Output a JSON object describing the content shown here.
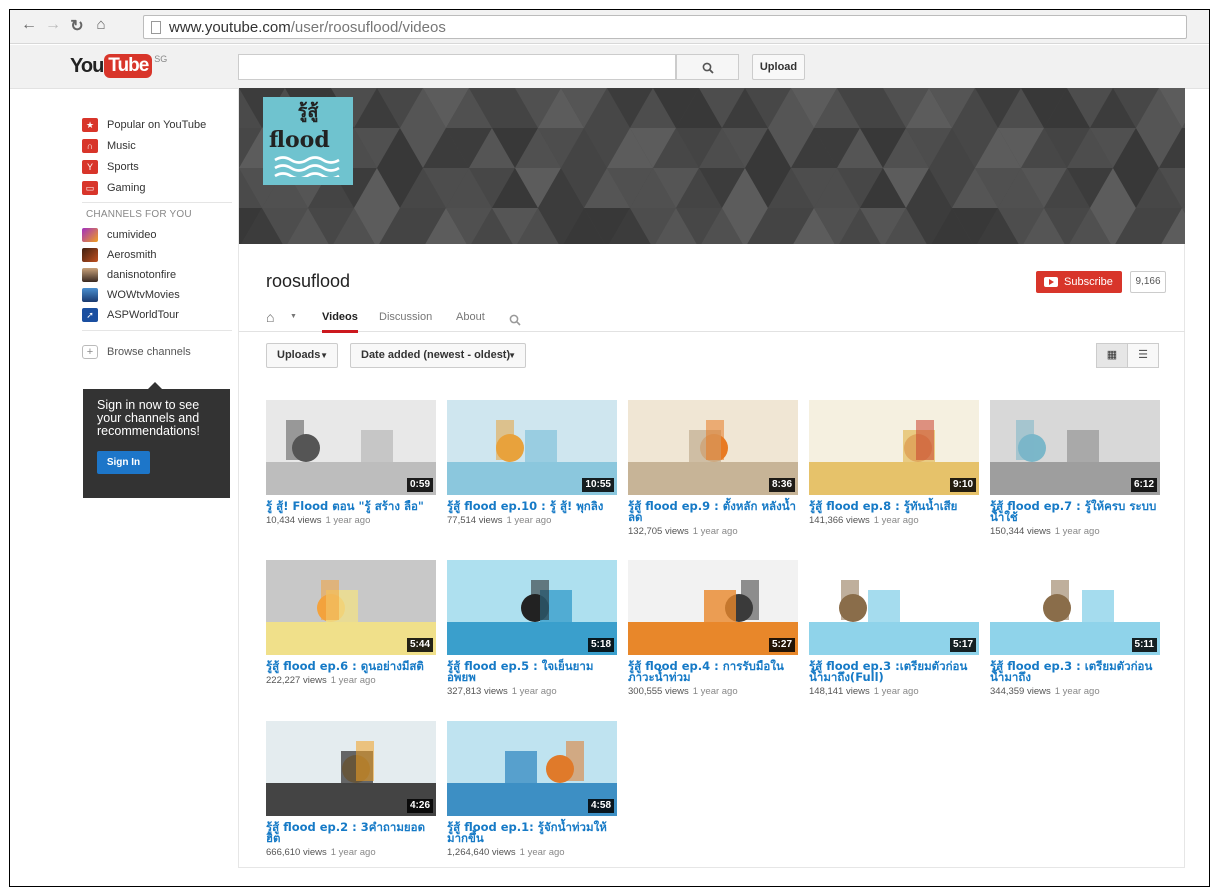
{
  "browser": {
    "url_host": "www.youtube.com",
    "url_path": "/user/roosuflood/videos"
  },
  "masthead": {
    "logo_you": "You",
    "logo_tube": "Tube",
    "region": "SG",
    "search_value": "",
    "upload_label": "Upload"
  },
  "guide": {
    "items": [
      {
        "label": "Popular on YouTube",
        "icon": "popular-icon",
        "color": "#d8352a"
      },
      {
        "label": "Music",
        "icon": "music-icon",
        "color": "#d8352a"
      },
      {
        "label": "Sports",
        "icon": "sports-icon",
        "color": "#d8352a"
      },
      {
        "label": "Gaming",
        "icon": "gaming-icon",
        "color": "#d8352a"
      }
    ],
    "channels_heading": "CHANNELS FOR YOU",
    "channels": [
      {
        "label": "cumivideo"
      },
      {
        "label": "Aerosmith"
      },
      {
        "label": "danisnotonfire"
      },
      {
        "label": "WOWtvMovies"
      },
      {
        "label": "ASPWorldTour"
      }
    ],
    "browse_label": "Browse channels",
    "signin_prompt": "Sign in now to see your channels and recommendations!",
    "signin_button": "Sign In"
  },
  "channel": {
    "logo_thai": "รู้สู้",
    "logo_word": "flood",
    "name": "roosuflood",
    "subscribe_label": "Subscribe",
    "subscriber_count": "9,166",
    "tabs": [
      "Videos",
      "Discussion",
      "About"
    ],
    "active_tab": "Videos",
    "uploads_label": "Uploads",
    "sort_label": "Date added (newest - oldest)"
  },
  "videos": [
    {
      "title": "รู้ สู้! Flood ตอน \"รู้ สร้าง ลือ\"",
      "views": "10,434 views",
      "ago": "1 year ago",
      "duration": "0:59"
    },
    {
      "title": "รู้สู้ flood ep.10 : รู้ สู้! พุกลิง",
      "views": "77,514 views",
      "ago": "1 year ago",
      "duration": "10:55"
    },
    {
      "title": "รู้สู้ flood ep.9 : ตั้งหลัก หลังน้ำลด",
      "views": "132,705 views",
      "ago": "1 year ago",
      "duration": "8:36"
    },
    {
      "title": "รู้สู้ flood ep.8 : รู้ทันน้ำเสีย",
      "views": "141,366 views",
      "ago": "1 year ago",
      "duration": "9:10"
    },
    {
      "title": "รู้สู้ flood ep.7 : รู้ให้ครบ ระบบน้ำใช้",
      "views": "150,344 views",
      "ago": "1 year ago",
      "duration": "6:12"
    },
    {
      "title": "รู้สู้ flood ep.6 : ดูนอย่างมีสติ",
      "views": "222,227 views",
      "ago": "1 year ago",
      "duration": "5:44"
    },
    {
      "title": "รู้สู้ flood ep.5 : ใจเย็นยามอพยพ",
      "views": "327,813 views",
      "ago": "1 year ago",
      "duration": "5:18"
    },
    {
      "title": "รู้สู้ flood ep.4 : การรับมือในภาวะน้ำท่วม",
      "views": "300,555 views",
      "ago": "1 year ago",
      "duration": "5:27"
    },
    {
      "title": "รู้สู้ flood ep.3 :เตรียมตัวก่อนน้ำมาถึง(Full)",
      "views": "148,141 views",
      "ago": "1 year ago",
      "duration": "5:17"
    },
    {
      "title": "รู้สู้ flood ep.3 : เตรียมตัวก่อนน้ำมาถึง",
      "views": "344,359 views",
      "ago": "1 year ago",
      "duration": "5:11"
    },
    {
      "title": "รู้สู้ flood ep.2 : 3คำถามยอดฮิต",
      "views": "666,610 views",
      "ago": "1 year ago",
      "duration": "4:26"
    },
    {
      "title": "รู้สู้ flood ep.1: รู้จักน้ำท่วมให้มากขึ้น",
      "views": "1,264,640 views",
      "ago": "1 year ago",
      "duration": "4:58"
    }
  ]
}
